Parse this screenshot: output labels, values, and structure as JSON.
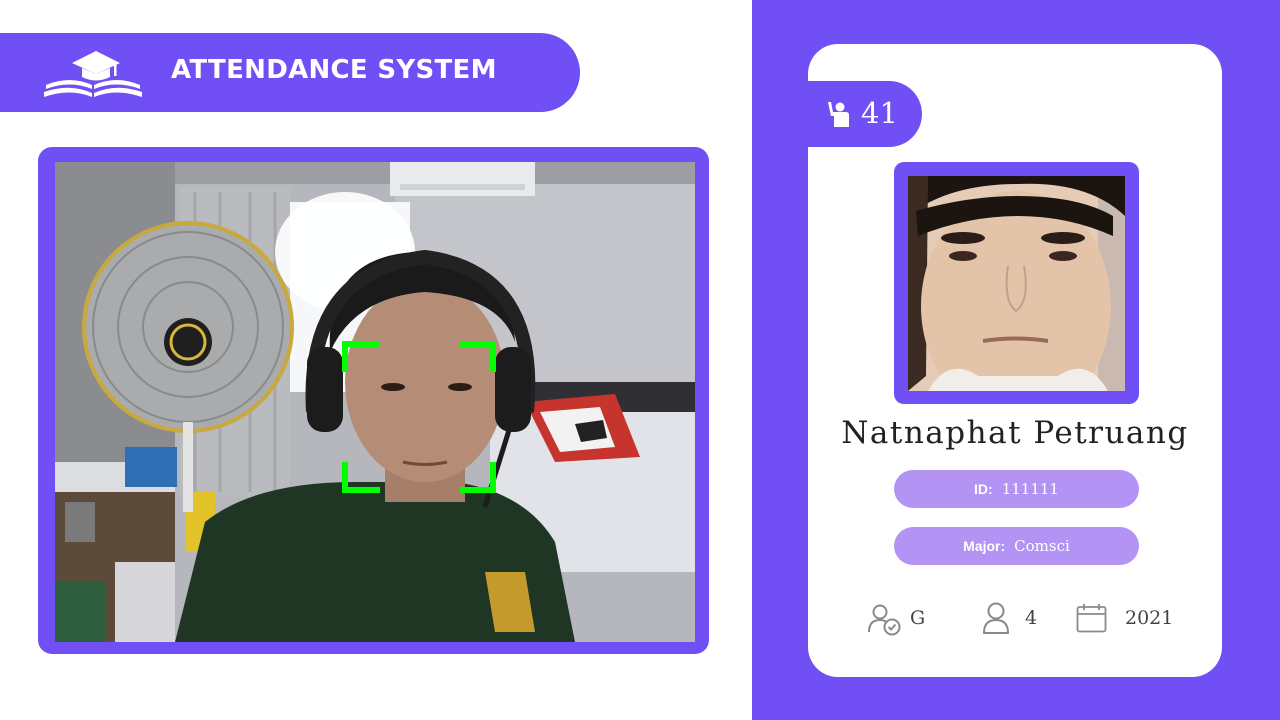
{
  "app": {
    "title": "ATTENDANCE SYSTEM",
    "logo_icon": "graduation-book-icon"
  },
  "camera": {
    "face_box_color": "#00ff00",
    "feed": "live-webcam-feed"
  },
  "card": {
    "mode_icon": "student-raise-hand-icon",
    "total_attendance": "41",
    "name": "Natnaphat Petruang",
    "id_label": "ID:",
    "id_value": "111111",
    "major_label": "Major:",
    "major_value": "Comsci",
    "standing_icon": "user-check-icon",
    "standing_value": "G",
    "year_icon": "user-icon",
    "year_value": "4",
    "starting_year_icon": "calendar-icon",
    "starting_year_value": "2021"
  },
  "colors": {
    "accent": "#7050f5",
    "pill": "#b394f4",
    "card": "#ffffff"
  }
}
